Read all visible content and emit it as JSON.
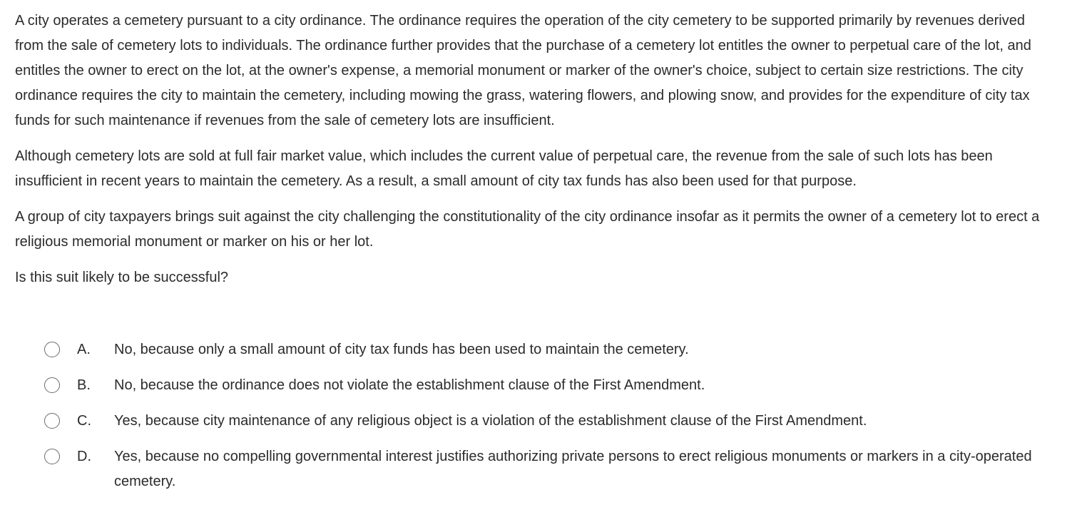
{
  "question": {
    "paragraphs": [
      "A city operates a cemetery pursuant to a city ordinance.  The ordinance requires the operation of the city cemetery to be supported primarily by revenues derived from the sale of cemetery lots to individuals.  The ordinance further provides that the purchase of a cemetery lot entitles the owner to perpetual care of the lot, and entitles the owner to erect on the lot, at the owner's expense, a memorial monument or marker of the owner's choice, subject to certain size restrictions.  The city ordinance requires the city to maintain the cemetery, including mowing the grass, watering flowers, and plowing snow, and provides for the expenditure of city tax funds for such maintenance if revenues from the sale of cemetery lots are insufficient.",
      "Although cemetery lots are sold at full fair market value, which includes the current value of perpetual care, the revenue from the sale of such lots has been insufficient in recent years to maintain the cemetery.  As a result, a small amount of city tax funds has also been used for that purpose.",
      "A group of city taxpayers brings suit against the city challenging the constitutionality of the city ordinance insofar as it permits the owner of a cemetery lot to erect a religious memorial monument or marker on his or her lot."
    ],
    "stem": "Is this suit likely to be successful?"
  },
  "choices": [
    {
      "letter": "A.",
      "text": "No, because only a small amount of city tax funds has been used to maintain the cemetery.",
      "selected": false
    },
    {
      "letter": "B.",
      "text": "No, because the ordinance does not violate the establishment clause of the First Amendment.",
      "selected": false
    },
    {
      "letter": "C.",
      "text": "Yes, because city maintenance of any religious object is a violation of the establishment clause of the First Amendment.",
      "selected": false
    },
    {
      "letter": "D.",
      "text": "Yes, because no compelling governmental interest justifies authorizing private persons to erect religious monuments or markers in a city-operated cemetery.",
      "selected": false
    }
  ]
}
